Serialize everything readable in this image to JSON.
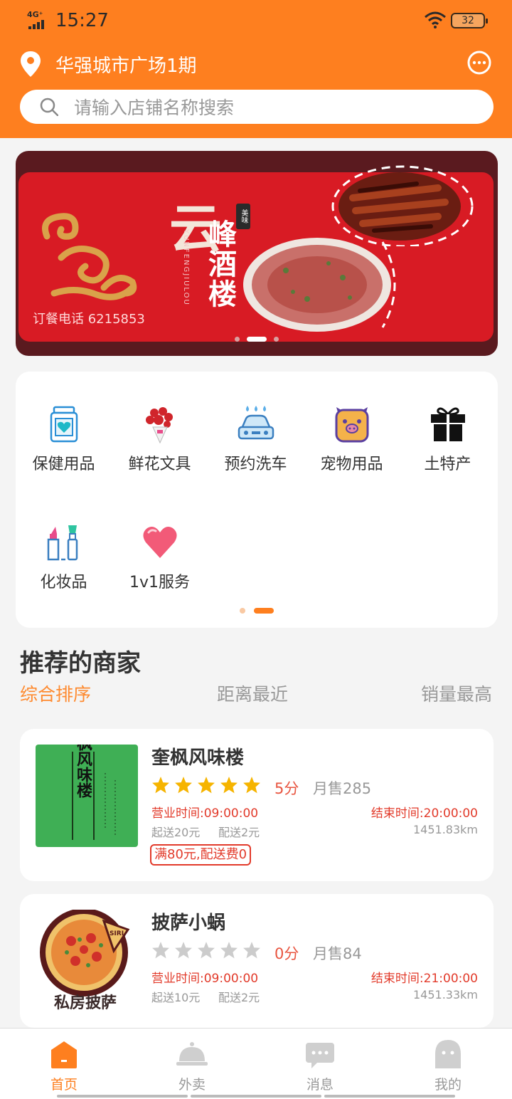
{
  "status_bar": {
    "network": "4G⁺",
    "time": "15:27",
    "battery": "32"
  },
  "header": {
    "location": "华强城市广场1期",
    "search_placeholder": "请输入店铺名称搜索"
  },
  "banner": {
    "brand_char": "云",
    "tag": "美味",
    "venue_name": "峰酒楼",
    "pinyin": "YUNFENGJIULOU",
    "phone": "订餐电话 6215853",
    "page_count": 3,
    "active_page": 2
  },
  "categories": [
    {
      "label": "保健用品",
      "icon": "health-jar-icon"
    },
    {
      "label": "鲜花文具",
      "icon": "flower-bouquet-icon"
    },
    {
      "label": "预约洗车",
      "icon": "car-wash-icon"
    },
    {
      "label": "宠物用品",
      "icon": "pet-pig-icon"
    },
    {
      "label": "土特产",
      "icon": "gift-box-icon"
    },
    {
      "label": "化妆品",
      "icon": "cosmetics-icon"
    },
    {
      "label": "1v1服务",
      "icon": "heart-icon"
    }
  ],
  "categories_pager": {
    "pages": 2,
    "active": 2
  },
  "section": {
    "title": "推荐的商家",
    "sort_options": [
      "综合排序",
      "距离最近",
      "销量最高"
    ],
    "active_sort": 0
  },
  "shops": [
    {
      "name": "奎枫风味楼",
      "thumb_text": "奎枫风味楼",
      "rating": 5,
      "score": "5分",
      "monthly_sales": "月售285",
      "open_time": "营业时间:09:00:00",
      "close_time": "结束时间:20:00:00",
      "min_order": "起送20元",
      "delivery_fee": "配送2元",
      "distance": "1451.83km",
      "promo": "满80元,配送费0"
    },
    {
      "name": "披萨小蜗",
      "thumb_text": "私房披萨",
      "thumb_badge": "SIRI",
      "rating": 0,
      "score": "0分",
      "monthly_sales": "月售84",
      "open_time": "营业时间:09:00:00",
      "close_time": "结束时间:21:00:00",
      "min_order": "起送10元",
      "delivery_fee": "配送2元",
      "distance": "1451.33km"
    }
  ],
  "tabbar": {
    "tabs": [
      {
        "label": "首页",
        "icon": "home-icon"
      },
      {
        "label": "外卖",
        "icon": "cloche-icon"
      },
      {
        "label": "消息",
        "icon": "message-icon"
      },
      {
        "label": "我的",
        "icon": "profile-icon"
      }
    ],
    "active": 0
  },
  "colors": {
    "accent": "#fe7f1f",
    "price_red": "#e23a2a",
    "star": "#f6b400"
  }
}
